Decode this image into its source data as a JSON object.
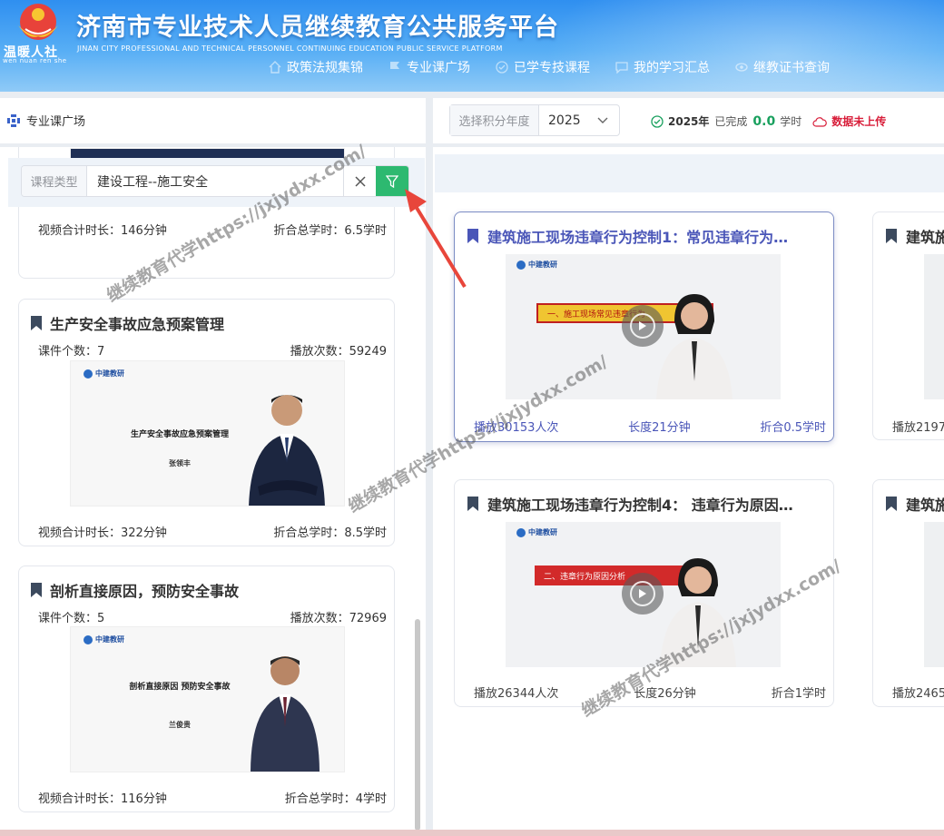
{
  "header": {
    "logo_text": "温暖人社",
    "logo_sub": "wen nuan ren she",
    "title": "济南市专业技术人员继续教育公共服务平台",
    "subtitle": "JINAN CITY PROFESSIONAL AND TECHNICAL PERSONNEL CONTINUING EDUCATION PUBLIC SERVICE PLATFORM",
    "nav": [
      "政策法规集锦",
      "专业课广场",
      "已学专技课程",
      "我的学习汇总",
      "继教证书查询"
    ]
  },
  "leftbar": {
    "title": "专业课广场"
  },
  "rightbar": {
    "year_label": "选择积分年度",
    "year_value": "2025",
    "status_year": "2025年",
    "status_done": "已完成",
    "status_hours": "0.0",
    "status_unit": "学时",
    "status_warn": "数据未上传"
  },
  "filter": {
    "label": "课程类型",
    "value": "建设工程--施工安全"
  },
  "courses": [
    {
      "duration": "视频合计时长：146分钟",
      "credit": "折合总学时：6.5学时"
    },
    {
      "title": "生产安全事故应急预案管理",
      "count": "课件个数：7",
      "plays": "播放次数：59249",
      "thumb_title": "生产安全事故应急预案管理",
      "thumb_author": "张领丰",
      "duration": "视频合计时长：322分钟",
      "credit": "折合总学时：8.5学时"
    },
    {
      "title": "剖析直接原因，预防安全事故",
      "count": "课件个数：5",
      "plays": "播放次数：72969",
      "thumb_title": "剖析直接原因  预防安全事故",
      "thumb_author": "兰俊贵",
      "duration": "视频合计时长：116分钟",
      "credit": "折合总学时：4学时"
    }
  ],
  "thumb_brand": "中建教研",
  "videos": [
    {
      "title": "建筑施工现场违章行为控制1：常见违章行为…",
      "banner": "一、施工现场常见违章行为",
      "plays": "播放30153人次",
      "length": "长度21分钟",
      "credit": "折合0.5学时"
    },
    {
      "title": "建筑施工现场违章行为控制4： 违章行为原因…",
      "banner": "二、违章行为原因分析",
      "plays": "播放26344人次",
      "length": "长度26分钟",
      "credit": "折合1学时"
    },
    {
      "title": "建筑施",
      "plays": "播放2197"
    },
    {
      "title": "建筑施",
      "plays": "播放2465"
    }
  ],
  "watermark": "继续教育代学https://jxjydxx.com/"
}
